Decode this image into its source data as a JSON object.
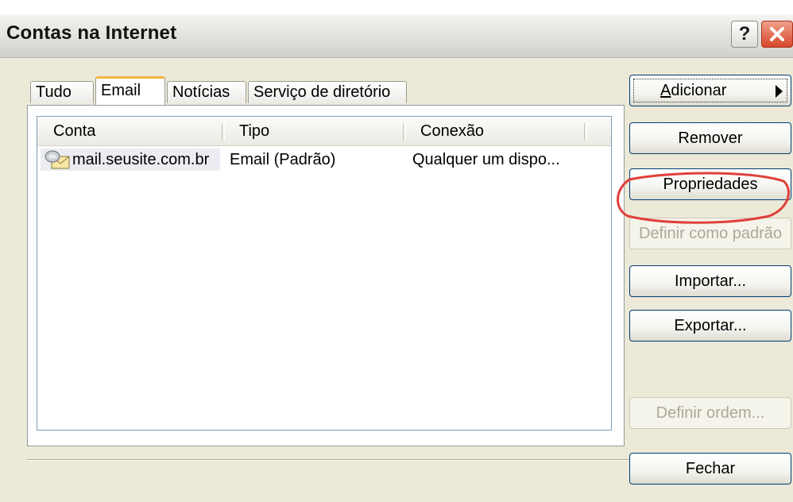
{
  "window": {
    "title": "Contas na Internet",
    "help_label": "?",
    "close_label": "✕"
  },
  "tabs": [
    {
      "label": "Tudo",
      "active": false
    },
    {
      "label": "Email",
      "active": true
    },
    {
      "label": "Notícias",
      "active": false
    },
    {
      "label": "Serviço de diretório",
      "active": false
    }
  ],
  "accounts_list": {
    "columns": [
      "Conta",
      "Tipo",
      "Conexão"
    ],
    "rows": [
      {
        "icon": "mail-account-icon",
        "account": "mail.seusite.com.br",
        "type": "Email (Padrão)",
        "connection": "Qualquer um dispo..."
      }
    ]
  },
  "buttons": {
    "add_prefix": "A",
    "add_rest": "dicionar",
    "remove": "Remover",
    "properties": "Propriedades",
    "set_default": "Definir como padrão",
    "import": "Importar...",
    "export": "Exportar...",
    "set_order": "Definir ordem...",
    "close": "Fechar"
  },
  "colors": {
    "highlight_ring": "#e0403a",
    "active_tab_accent": "#f2b544",
    "button_border": "#003c74"
  }
}
